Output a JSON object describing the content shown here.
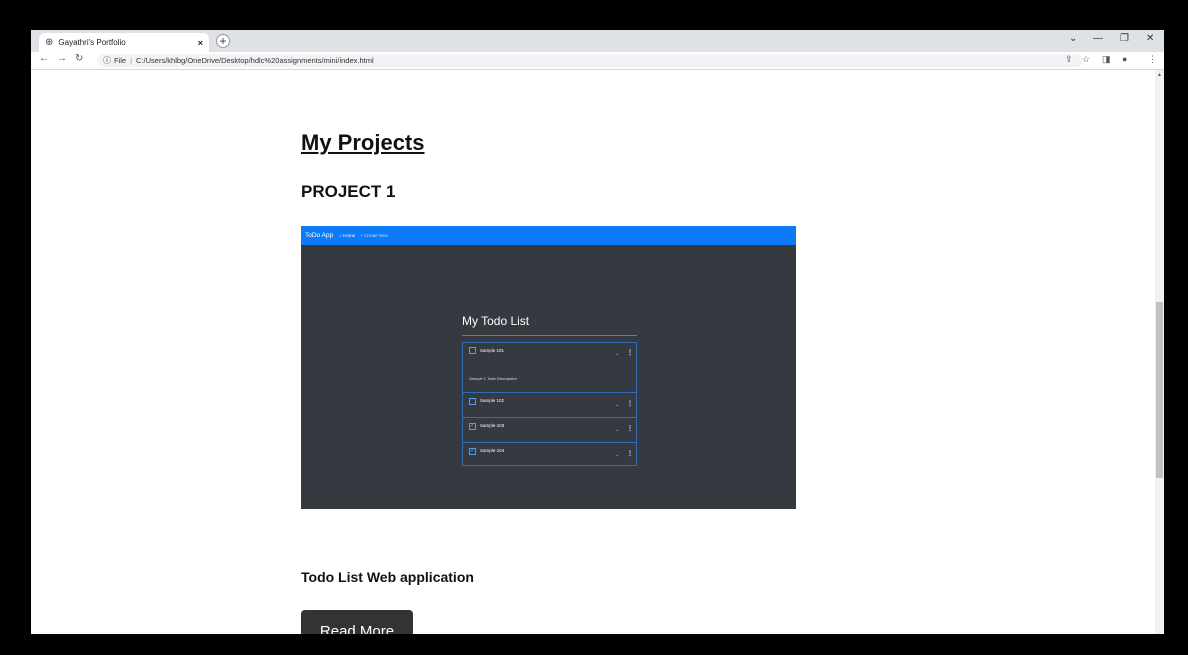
{
  "browser": {
    "tab_title": "Gayathri's Portfolio",
    "tab_close": "×",
    "new_tab": "+",
    "address_label": "File",
    "address_url": "C:/Users/khlbg/OneDrive/Desktop/hdlc%20assignments/mini/index.html"
  },
  "page": {
    "section_title": "My Projects",
    "project_title": "PROJECT 1",
    "screenshot": {
      "brand": "ToDo App",
      "nav_home": "Home",
      "nav_create": "Create New",
      "heading": "My Todo List",
      "items": [
        {
          "label": "Sample 101",
          "checked": false
        },
        {
          "label": "Sample 102",
          "checked": false
        },
        {
          "label": "Sample-103",
          "checked": true
        },
        {
          "label": "Sample-104",
          "checked": true
        }
      ],
      "description": "Sample 1 Todo Description"
    },
    "project_name": "Todo List Web application",
    "read_more": "Read More"
  }
}
